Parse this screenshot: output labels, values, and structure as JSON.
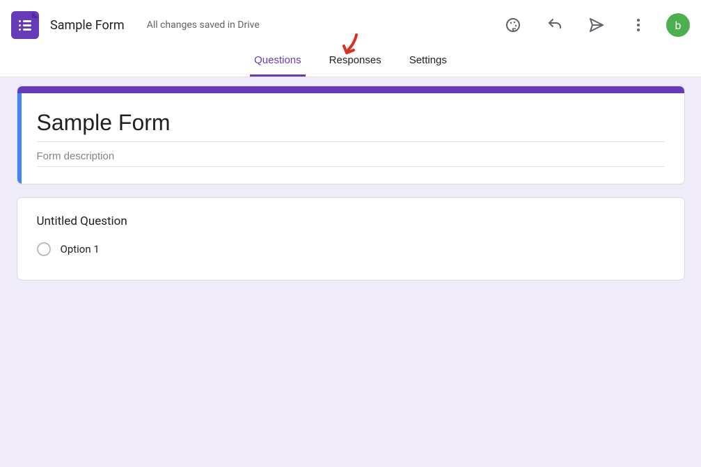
{
  "header": {
    "title": "Sample Form",
    "save_status": "All changes saved in Drive",
    "avatar_letter": "b"
  },
  "tabs": {
    "questions": "Questions",
    "responses": "Responses",
    "settings": "Settings"
  },
  "form": {
    "title": "Sample Form",
    "description_placeholder": "Form description",
    "description_value": ""
  },
  "question": {
    "text": "Untitled Question",
    "options": [
      "Option 1"
    ]
  },
  "icons": {
    "theme": "palette-icon",
    "undo": "undo-icon",
    "send": "send-icon",
    "more": "more-vert-icon"
  }
}
